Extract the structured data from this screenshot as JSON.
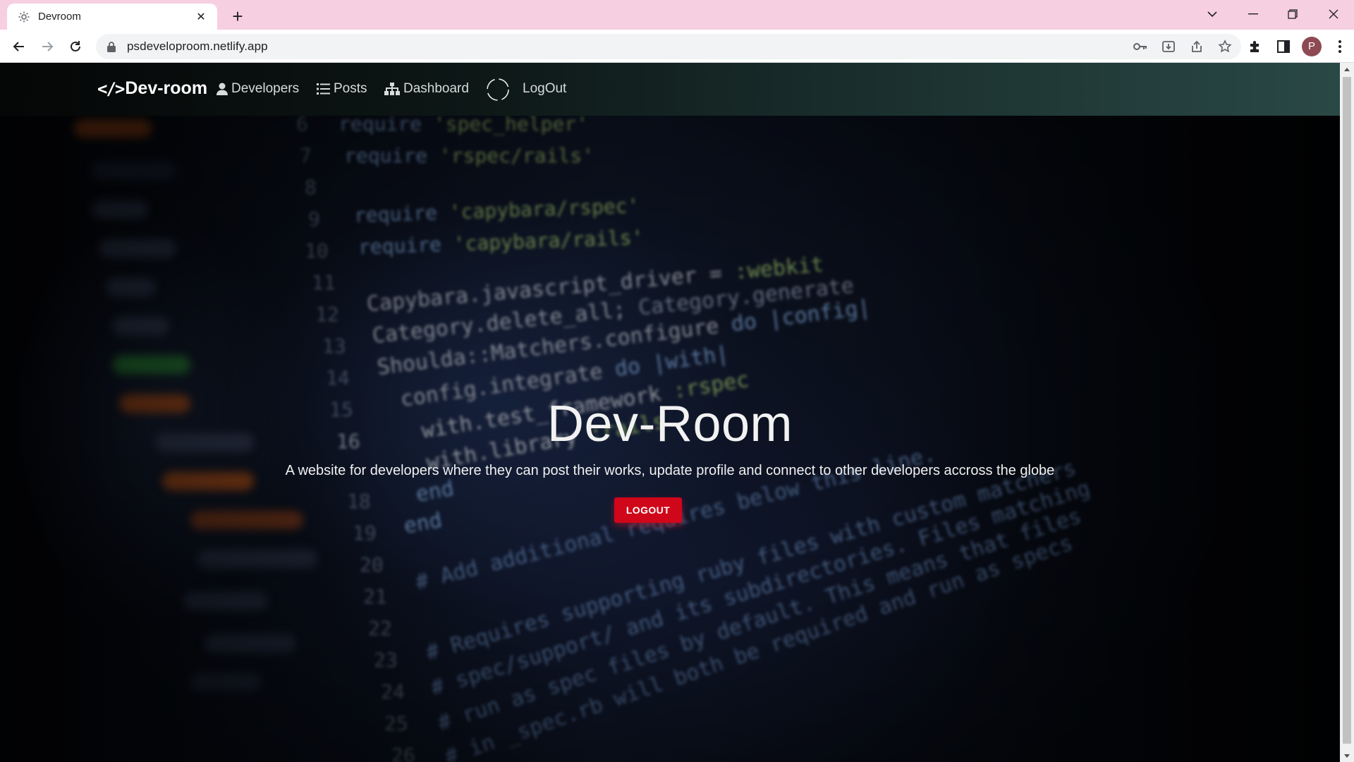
{
  "browser": {
    "tab_title": "Devroom",
    "url": "psdeveloproom.netlify.app",
    "profile_initial": "P"
  },
  "navbar": {
    "brand": "Dev-room",
    "links": [
      {
        "label": "Developers",
        "icon": "user-icon"
      },
      {
        "label": "Posts",
        "icon": "list-icon"
      },
      {
        "label": "Dashboard",
        "icon": "sitemap-icon"
      },
      {
        "label": "LogOut",
        "icon": "loading-spinner-icon"
      }
    ]
  },
  "hero": {
    "title": "Dev-Room",
    "subtitle": "A website for developers where they can post their works, update profile and connect to other developers accross the globe",
    "button_label": "LOGOUT"
  },
  "colors": {
    "accent": "#d0061a",
    "navbar_start": "#050606",
    "navbar_end": "#2a4846",
    "tabstrip": "#f6cfe0"
  }
}
